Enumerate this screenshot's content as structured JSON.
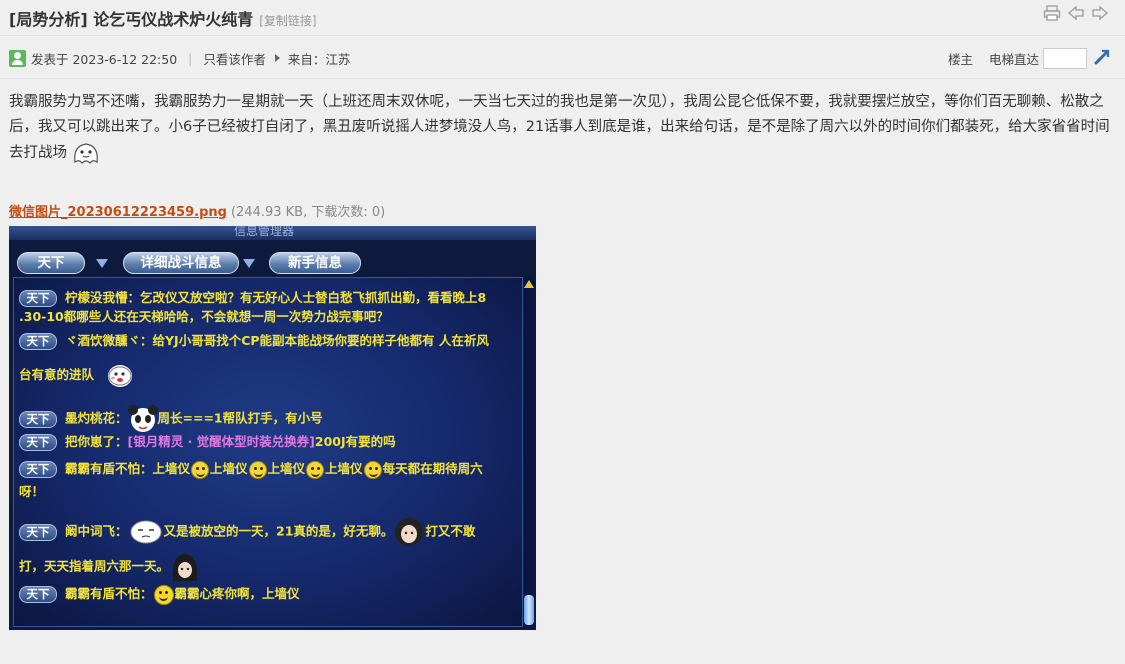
{
  "header": {
    "title": "[局势分析] 论乞丐仪战术炉火纯青",
    "copy_link": "[复制链接]",
    "icons": [
      "print-icon",
      "prev-thread-icon",
      "next-thread-icon"
    ]
  },
  "meta": {
    "posted": "发表于 2023-6-12 22:50",
    "author_only": "只看该作者",
    "origin": "来自：江苏",
    "floor": "楼主",
    "jump_label": "电梯直达",
    "jump_value": ""
  },
  "post": {
    "body": "我霸服势力骂不还嘴，我霸服势力一星期就一天（上班还周末双休呢，一天当七天过的我也是第一次见），我周公昆仑低保不要，我就要摆烂放空，等你们百无聊赖、松散之后，我又可以跳出来了。小6子已经被打自闭了，黑丑废听说摇人进梦境没人鸟，21话事人到底是谁，出来给句话，是不是除了周六以外的时间你们都装死，给大家省省时间去打战场"
  },
  "attachment": {
    "name": "微信图片_20230612223459.png",
    "info": "(244.93 KB, 下载次数: 0)"
  },
  "game": {
    "window_title": "信息管理器",
    "tabs": [
      "天下",
      "详细战斗信息",
      "新手信息"
    ],
    "badge": "天下",
    "messages": [
      {
        "t1": "柠檬没我懵：乞改仪又放空啦？有无好心人士替白愁飞抓抓出勤，看看晚上8",
        "t2": ".30-10都哪些人还在天梯哈哈，不会就想一周一次势力战完事吧？"
      },
      {
        "t1": "ヾ酒饮微醺ヾ：给YJ小哥哥找个CP能副本能战场你要的样子他都有 人在祈风",
        "t2": "台有意的进队"
      },
      {
        "t1": "墨灼桃花：",
        "t1b": "周长===1帮队打手，有小号"
      },
      {
        "t1": "把你崽了：",
        "t1b": "[银月精灵 · 觉醒体型时装兑换券]",
        "t1c": "200J有要的吗"
      },
      {
        "t1": "霸霸有盾不怕：上墙仪",
        "t1b": "上墙仪",
        "t1c": "上墙仪",
        "t1d": "上墙仪",
        "t1e": "每天都在期待周六",
        "t2": "呀！"
      },
      {
        "t1": "阚中词飞：",
        "t1b": "又是被放空的一天，21真的是，好无聊。",
        "t1c": "打又不敢",
        "t2": "打，天天指着周六那一天。"
      },
      {
        "t1": "霸霸有盾不怕：",
        "t1b": "霸霸心疼你啊，上墙仪"
      }
    ]
  }
}
